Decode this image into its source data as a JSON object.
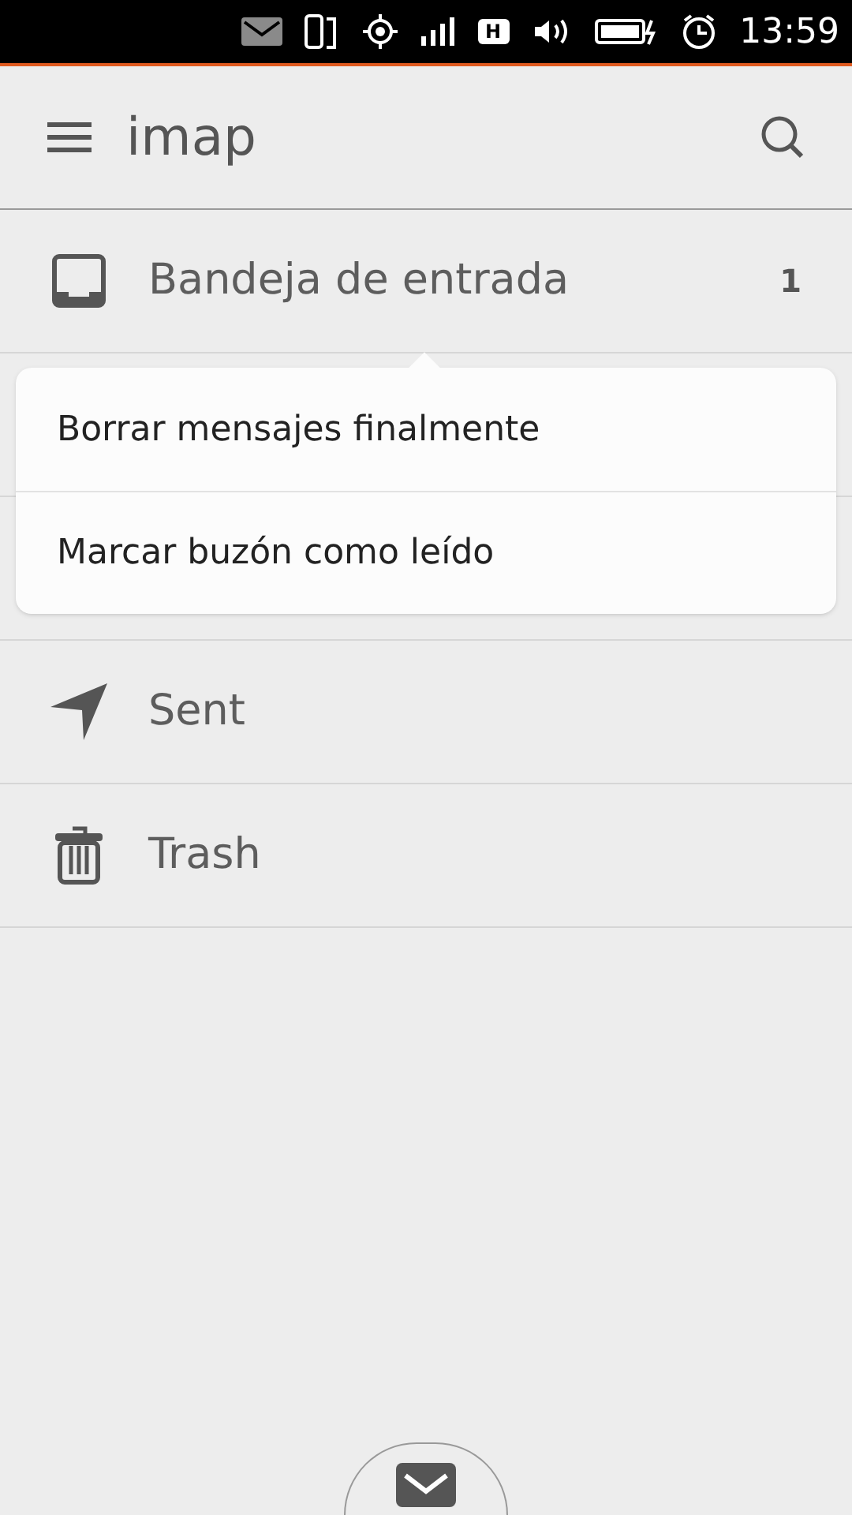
{
  "status_bar": {
    "network_type": "H",
    "time": "13:59"
  },
  "header": {
    "title": "imap"
  },
  "folders": [
    {
      "kind": "inbox",
      "label": "Bandeja de entrada",
      "count": "1"
    },
    {
      "kind": "sent",
      "label": "Sent"
    },
    {
      "kind": "trash",
      "label": "Trash"
    }
  ],
  "popup_menu": [
    {
      "label": "Borrar mensajes finalmente"
    },
    {
      "label": "Marcar buzón como leído"
    }
  ]
}
